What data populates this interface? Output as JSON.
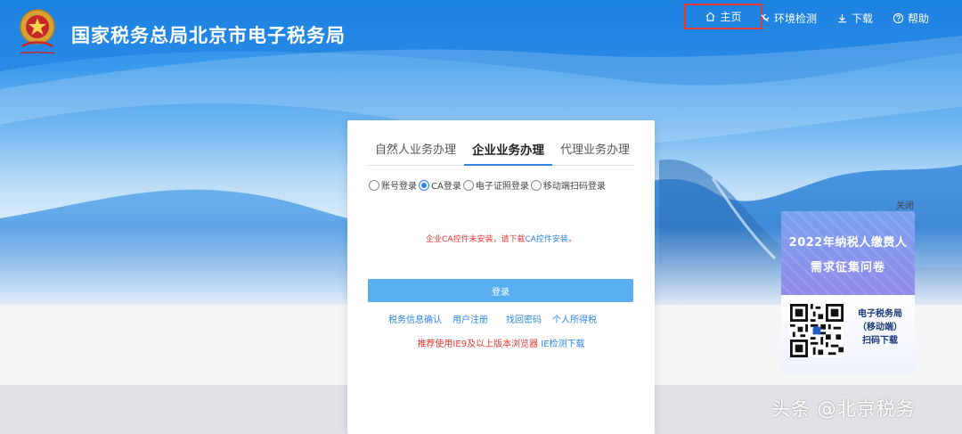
{
  "header": {
    "site_title": "国家税务总局北京市电子税务局",
    "nav": {
      "home": "主页",
      "env_check": "环境检测",
      "download": "下载",
      "help": "帮助"
    }
  },
  "login": {
    "tabs": [
      "自然人业务办理",
      "企业业务办理",
      "代理业务办理"
    ],
    "active_tab": "企业业务办理",
    "methods": [
      "账号登录",
      "CA登录",
      "电子证照登录",
      "移动端扫码登录"
    ],
    "selected_method": "CA登录",
    "ca_warning_prefix": "企业CA控件未安装，请下载",
    "ca_warning_link": "CA控件安装",
    "ca_warning_suffix": "。",
    "submit": "登录",
    "links": [
      "税务信息确认",
      "用户注册",
      "找回密码",
      "个人所得税"
    ],
    "browser_tip": "推荐使用IE9及以上版本浏览器",
    "ie_check_link": "IE检测下载"
  },
  "promo": {
    "close": "关闭",
    "title_line1": "2022年纳税人缴费人",
    "title_line2": "需求征集问卷",
    "qr_line1": "电子税务局",
    "qr_line2": "（移动端）",
    "qr_line3": "扫码下载"
  },
  "watermark": "头条 @北京税务",
  "colors": {
    "accent": "#2f86e8",
    "warning": "#e53935",
    "button": "#57aef0"
  }
}
